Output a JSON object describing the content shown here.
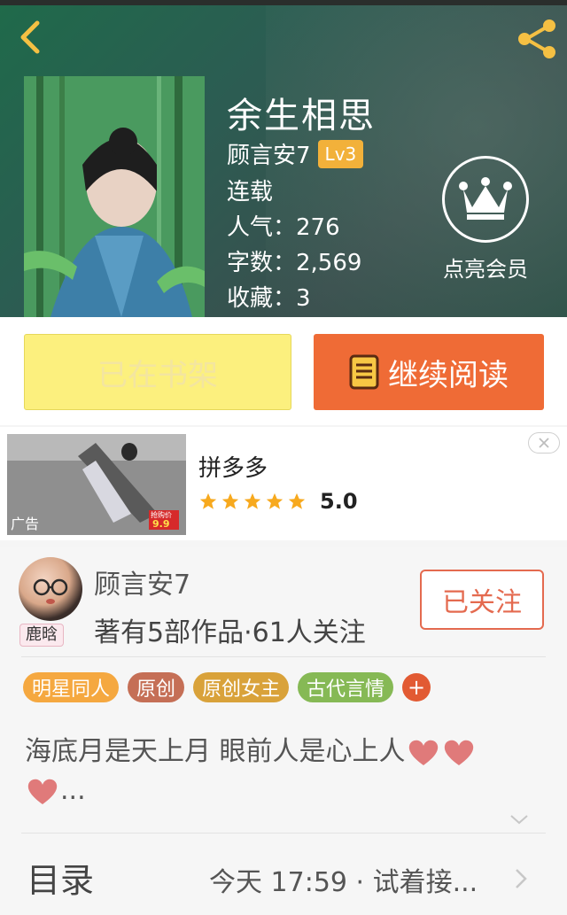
{
  "header": {
    "book_title": "余生相思",
    "author": "顾言安7",
    "level": "Lv3",
    "status": "连载",
    "popularity": "人气：276",
    "word_count": "字数：2,569",
    "favorites": "收藏：3",
    "vip_label": "点亮会员"
  },
  "actions": {
    "shelf_label": "已在书架",
    "read_label": "继续阅读"
  },
  "ad": {
    "title": "拼多多",
    "rating": "5.0",
    "stars": 5,
    "tag": "广告",
    "promo_text": "抢购价",
    "promo_price": "9.9"
  },
  "author_section": {
    "name": "顾言安7",
    "avatar_tag": "鹿晗",
    "stats": "著有5部作品·61人关注",
    "follow_label": "已关注",
    "tags": [
      {
        "label": "明星同人",
        "color": "#f5a840"
      },
      {
        "label": "原创",
        "color": "#c56f56"
      },
      {
        "label": "原创女主",
        "color": "#d9a23a"
      },
      {
        "label": "古代言情",
        "color": "#86b955"
      }
    ],
    "add_tag": "+",
    "add_tag_color": "#e25a33",
    "description_text": "海底月是天上月 眼前人是心上人",
    "description_ellipsis": "...",
    "toc_label": "目录",
    "toc_latest": "今天 17:59 · 试着接..."
  },
  "colors": {
    "read_button": "#ef6b36",
    "shelf_button": "#fcf07e",
    "level_badge": "#f2b13a",
    "heart": "#e07a7a",
    "star": "#f7a91e"
  },
  "icons": {
    "back": "back-arrow-icon",
    "share": "share-icon",
    "vip": "crown-icon",
    "book": "book-icon",
    "heart": "heart-icon",
    "star": "star-icon",
    "close": "close-icon",
    "expand": "chevron-down-icon",
    "toc": "chevron-right-icon"
  }
}
